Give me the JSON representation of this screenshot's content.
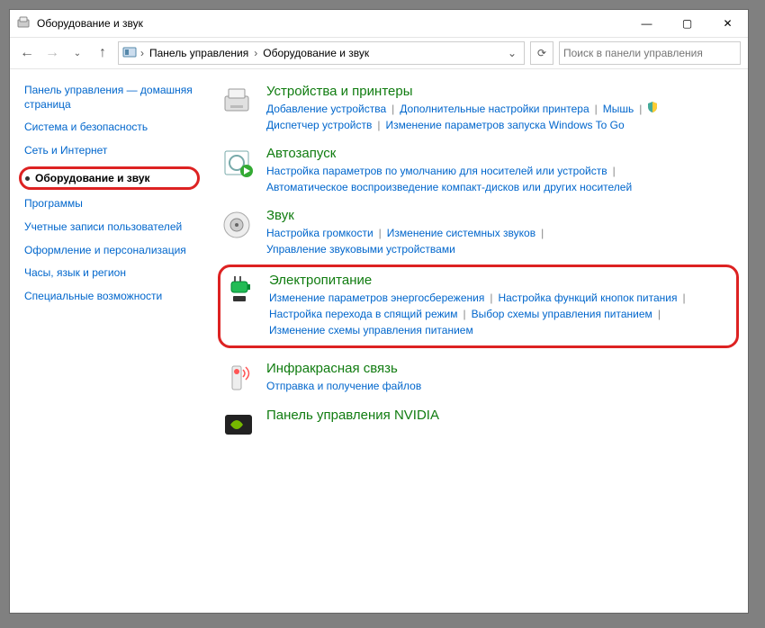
{
  "window": {
    "title": "Оборудование и звук"
  },
  "breadcrumb": {
    "item1": "Панель управления",
    "item2": "Оборудование и звук"
  },
  "search": {
    "placeholder": "Поиск в панели управления"
  },
  "sidebar": {
    "home": "Панель управления — домашняя страница",
    "items": [
      "Система и безопасность",
      "Сеть и Интернет",
      "Оборудование и звук",
      "Программы",
      "Учетные записи пользователей",
      "Оформление и персонализация",
      "Часы, язык и регион",
      "Специальные возможности"
    ]
  },
  "cats": {
    "devices": {
      "title": "Устройства и принтеры",
      "l1": "Добавление устройства",
      "l2": "Дополнительные настройки принтера",
      "l3": "Мышь",
      "l4": "Диспетчер устройств",
      "l5": "Изменение параметров запуска Windows To Go"
    },
    "autoplay": {
      "title": "Автозапуск",
      "l1": "Настройка параметров по умолчанию для носителей или устройств",
      "l2": "Автоматическое воспроизведение компакт-дисков или других носителей"
    },
    "sound": {
      "title": "Звук",
      "l1": "Настройка громкости",
      "l2": "Изменение системных звуков",
      "l3": "Управление звуковыми устройствами"
    },
    "power": {
      "title": "Электропитание",
      "l1": "Изменение параметров энергосбережения",
      "l2": "Настройка функций кнопок питания",
      "l3": "Настройка перехода в спящий режим",
      "l4": "Выбор схемы управления питанием",
      "l5": "Изменение схемы управления питанием"
    },
    "ir": {
      "title": "Инфракрасная связь",
      "l1": "Отправка и получение файлов"
    },
    "nvidia": {
      "title": "Панель управления NVIDIA"
    }
  }
}
